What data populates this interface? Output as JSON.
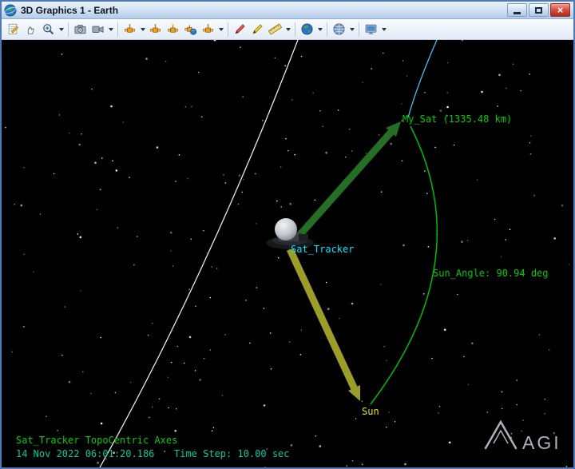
{
  "window": {
    "title": "3D Graphics 1 - Earth",
    "close_glyph": "×"
  },
  "toolbar": {
    "icons": [
      "new-note",
      "pan-hand",
      "zoom-in",
      "zoom-options-dropdown",
      "snapshot-camera",
      "video-recorder",
      "camera-options-dropdown",
      "sensor-view",
      "sensor-options-dropdown",
      "attitude-view",
      "solar-view",
      "sensor-globe-view",
      "vector-view",
      "vector-options-dropdown",
      "pencil-red",
      "pencil-yellow",
      "ruler",
      "annotation-options-dropdown",
      "globe-browser",
      "globe-options-dropdown",
      "terrain-globe",
      "terrain-options-dropdown",
      "display-settings",
      "display-options-dropdown"
    ]
  },
  "scene": {
    "satellite_label": "My_Sat (1335.48 km)",
    "tracker_label": "Sat_Tracker",
    "sun_angle_label": "Sun_Angle: 90.94 deg",
    "sun_label": "Sun",
    "overlay_axes": "Sat_Tracker TopoCentric Axes",
    "overlay_time": "14 Nov 2022 06:01:20.186",
    "overlay_step": "Time Step: 10.00 sec",
    "logo_text": "AGI",
    "colors": {
      "label_green": "#00cc00",
      "label_cyan": "#00e8ff",
      "label_yellow": "#e8e800",
      "time_text": "#00c8a0",
      "arrow_green": "#256e25",
      "arrow_yellow": "#9c9c28",
      "orbit_white": "#e8e8e8",
      "orbit_cyan": "#45c0ee",
      "angle_arc": "#00bb00",
      "background": "#000000"
    }
  }
}
